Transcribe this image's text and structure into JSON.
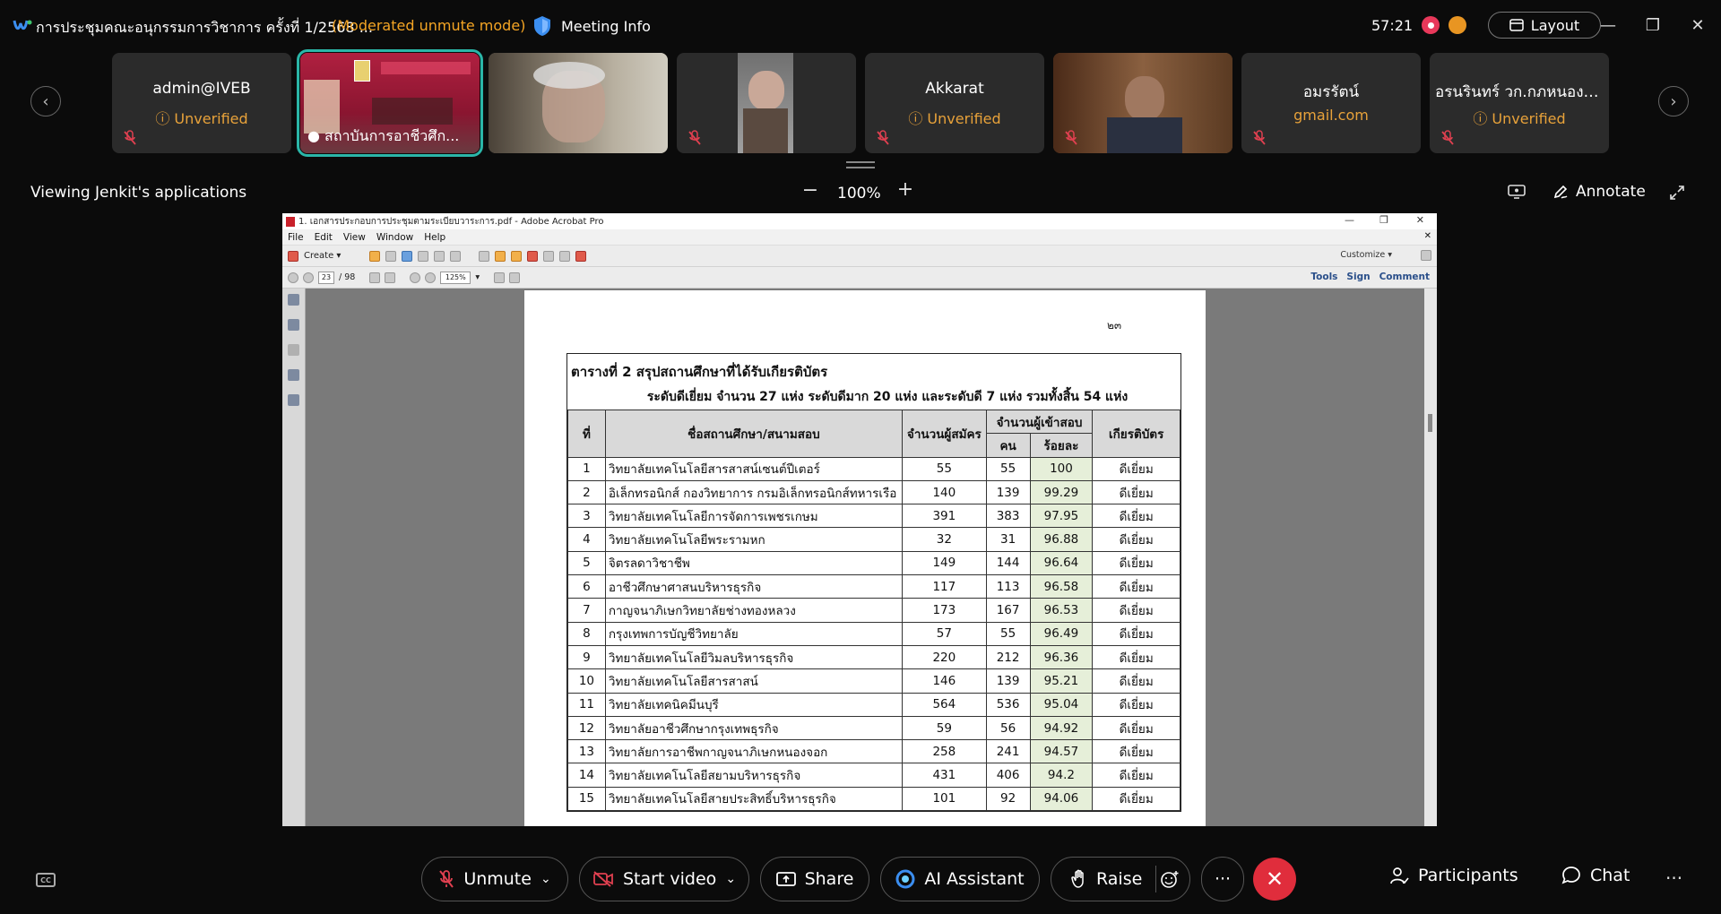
{
  "titlebar": {
    "meeting_title": "การประชุมคณะอนุกรรมการวิชาการ ครั้งที่ 1/2568 ...",
    "mode": "(Moderated unmute mode)",
    "meeting_info": "Meeting Info",
    "timer": "57:21",
    "layout_label": "Layout"
  },
  "participants": [
    {
      "name": "admin@IVEB",
      "sub": "Unverified"
    },
    {
      "label": "สถาบันการอาชีวศึก..."
    },
    {},
    {},
    {
      "name": "Akkarat",
      "sub": "Unverified"
    },
    {},
    {
      "name": "อมรรัตน์",
      "sub": "gmail.com"
    },
    {
      "name": "อรนรินทร์ วก.กภหนองจ...",
      "sub": "Unverified"
    }
  ],
  "viewbar": {
    "viewing_text": "Viewing Jenkit's applications",
    "zoom_minus": "−",
    "zoom": "100%",
    "zoom_plus": "+",
    "annotate": "Annotate"
  },
  "acrobat": {
    "title": "1. เอกสารประกอบการประชุมตามระเบียบวาระการ.pdf - Adobe Acrobat Pro",
    "menu": [
      "File",
      "Edit",
      "View",
      "Window",
      "Help"
    ],
    "create": "Create",
    "page_current": "23",
    "page_total": "/ 98",
    "zoom": "125%",
    "customize": "Customize",
    "links": [
      "Tools",
      "Sign",
      "Comment"
    ]
  },
  "document": {
    "page_number": "๒๓",
    "table_title": "ตารางที่ 2  สรุปสถานศึกษาที่ได้รับเกียรติบัตร",
    "table_subtitle": "ระดับดีเยี่ยม จำนวน 27 แห่ง ระดับดีมาก 20 แห่ง และระดับดี 7 แห่ง รวมทั้งสิ้น 54 แห่ง",
    "headers": {
      "no": "ที่",
      "name": "ชื่อสถานศึกษา/สนามสอบ",
      "applicants": "จำนวนผู้สมัคร",
      "examinees": "จำนวนผู้เข้าสอบ",
      "persons": "คน",
      "percent": "ร้อยละ",
      "certificate": "เกียรติบัตร"
    },
    "rows": [
      [
        "1",
        "วิทยาลัยเทคโนโลยีสารสาสน์เซนต์ปีเตอร์",
        "55",
        "55",
        "100",
        "ดีเยี่ยม"
      ],
      [
        "2",
        "อิเล็กทรอนิกส์ กองวิทยาการ กรมอิเล็กทรอนิกส์ทหารเรือ",
        "140",
        "139",
        "99.29",
        "ดีเยี่ยม"
      ],
      [
        "3",
        "วิทยาลัยเทคโนโลยีการจัดการเพชรเกษม",
        "391",
        "383",
        "97.95",
        "ดีเยี่ยม"
      ],
      [
        "4",
        "วิทยาลัยเทคโนโลยีพระรามหก",
        "32",
        "31",
        "96.88",
        "ดีเยี่ยม"
      ],
      [
        "5",
        "จิตรลดาวิชาชีพ",
        "149",
        "144",
        "96.64",
        "ดีเยี่ยม"
      ],
      [
        "6",
        "อาชีวศึกษาศาสนบริหารธุรกิจ",
        "117",
        "113",
        "96.58",
        "ดีเยี่ยม"
      ],
      [
        "7",
        "กาญจนาภิเษกวิทยาลัยช่างทองหลวง",
        "173",
        "167",
        "96.53",
        "ดีเยี่ยม"
      ],
      [
        "8",
        "กรุงเทพการบัญชีวิทยาลัย",
        "57",
        "55",
        "96.49",
        "ดีเยี่ยม"
      ],
      [
        "9",
        "วิทยาลัยเทคโนโลยีวิมลบริหารธุรกิจ",
        "220",
        "212",
        "96.36",
        "ดีเยี่ยม"
      ],
      [
        "10",
        "วิทยาลัยเทคโนโลยีสารสาสน์",
        "146",
        "139",
        "95.21",
        "ดีเยี่ยม"
      ],
      [
        "11",
        "วิทยาลัยเทคนิคมีนบุรี",
        "564",
        "536",
        "95.04",
        "ดีเยี่ยม"
      ],
      [
        "12",
        "วิทยาลัยอาชีวศึกษากรุงเทพธุรกิจ",
        "59",
        "56",
        "94.92",
        "ดีเยี่ยม"
      ],
      [
        "13",
        "วิทยาลัยการอาชีพกาญจนาภิเษกหนองจอก",
        "258",
        "241",
        "94.57",
        "ดีเยี่ยม"
      ],
      [
        "14",
        "วิทยาลัยเทคโนโลยีสยามบริหารธุรกิจ",
        "431",
        "406",
        "94.2",
        "ดีเยี่ยม"
      ],
      [
        "15",
        "วิทยาลัยเทคโนโลยีสายประสิทธิ์บริหารธุรกิจ",
        "101",
        "92",
        "94.06",
        "ดีเยี่ยม"
      ]
    ]
  },
  "bottombar": {
    "unmute": "Unmute",
    "start_video": "Start video",
    "share": "Share",
    "ai_assistant": "AI Assistant",
    "raise": "Raise",
    "more": "···",
    "end": "✕",
    "participants": "Participants",
    "chat": "Chat",
    "overflow": "···"
  },
  "colors": {
    "accent_orange": "#f5a524",
    "end_red": "#e02d3c",
    "active_tile": "#2bb6a8",
    "percent_cell": "#e6efd9"
  }
}
